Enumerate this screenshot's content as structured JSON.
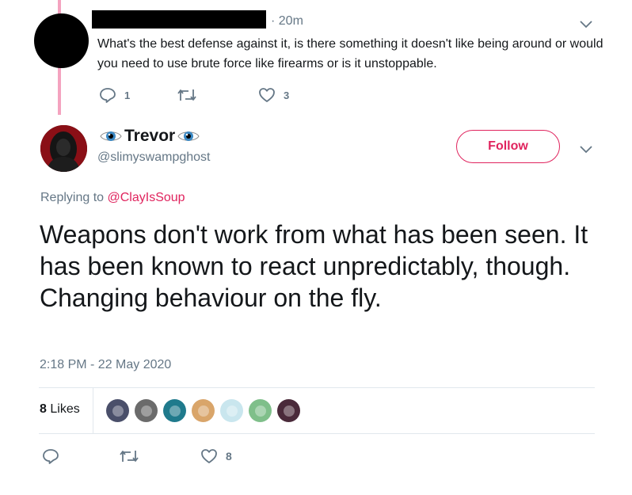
{
  "parent_reply": {
    "time": "20m",
    "text": "What's the best defense against it, is there something it doesn't like being around or would you need to use brute force like firearms or is it unstoppable.",
    "reply_count": "1",
    "like_count": "3",
    "icons": [
      "reply-icon",
      "retweet-icon",
      "heart-icon",
      "chevron-down-icon"
    ]
  },
  "tweet": {
    "display_name": "Trevor",
    "name_emoji": "eye-emoji",
    "handle": "@slimyswampghost",
    "follow_label": "Follow",
    "replying_prefix": "Replying to",
    "replying_to": "@ClayIsSoup",
    "text": "Weapons don't work from what has been seen. It has been known to react unpredictably, though. Changing behaviour on the fly.",
    "timestamp": "2:18 PM - 22 May 2020",
    "likes_count": "8",
    "likes_label": "Likes",
    "bottom_like_count": "8",
    "likers": [
      "#4a4f6a",
      "#6b6b6b",
      "#1f7a8c",
      "#d9a56a",
      "#c9e6ee",
      "#7fbf8a",
      "#4a2a3a"
    ]
  },
  "colors": {
    "accent": "#e0245e",
    "thread_line": "#f4a3bf",
    "muted": "#657786"
  }
}
